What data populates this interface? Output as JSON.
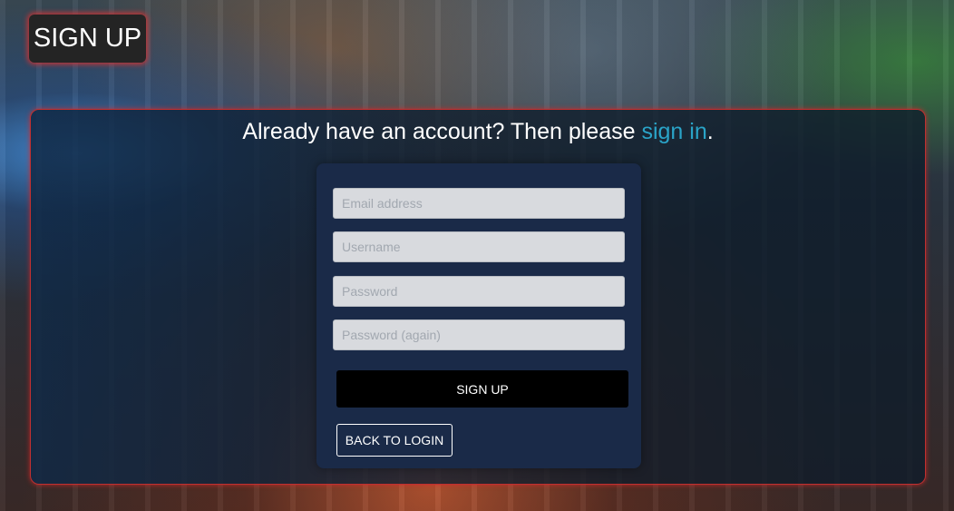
{
  "header": {
    "title": "SIGN UP"
  },
  "intro": {
    "prefix": "Already have an account? Then please ",
    "link": "sign in",
    "suffix": "."
  },
  "form": {
    "email_placeholder": "Email address",
    "username_placeholder": "Username",
    "password_placeholder": "Password",
    "password_again_placeholder": "Password (again)",
    "submit_label": "SIGN UP",
    "back_label": "BACK TO LOGIN"
  },
  "colors": {
    "link": "#2aa4c8",
    "panel_border": "#c03030",
    "card_background": "#1a2a48",
    "submit_background": "#000000"
  }
}
